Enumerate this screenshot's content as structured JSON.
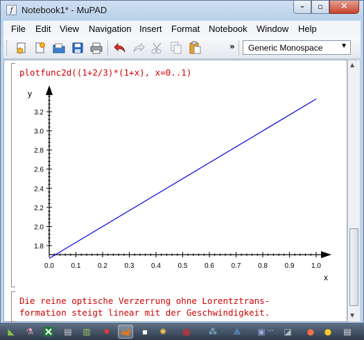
{
  "window": {
    "title": "Notebook1* - MuPAD",
    "app_icon": "mupad-icon",
    "controls": {
      "minimize": "–",
      "maximize": "▫",
      "close": "✕"
    }
  },
  "menubar": {
    "items": [
      "File",
      "Edit",
      "View",
      "Navigation",
      "Insert",
      "Format",
      "Notebook",
      "Window",
      "Help"
    ]
  },
  "toolbar": {
    "buttons": [
      "new-notebook-icon",
      "new-document-icon",
      "open-folder-icon",
      "save-icon",
      "print-icon",
      "undo-icon",
      "redo-icon",
      "cut-icon",
      "copy-icon",
      "paste-icon"
    ],
    "more_label": "»",
    "font_select": {
      "value": "Generic Monospace"
    }
  },
  "notebook": {
    "command": "plotfunc2d((1+2/3)*(1+x), x=0..1)",
    "text_lines": [
      "Die reine optische Verzerrung ohne Lorentztrans-",
      "formation steigt linear mit der Geschwindigkeit."
    ]
  },
  "chart_data": {
    "type": "line",
    "title": "",
    "xlabel": "x",
    "ylabel": "y",
    "xlim": [
      0,
      1
    ],
    "ylim": [
      1.6667,
      3.3333
    ],
    "x_ticks": [
      "0.0",
      "0.1",
      "0.2",
      "0.3",
      "0.4",
      "0.5",
      "0.6",
      "0.7",
      "0.8",
      "0.9",
      "1.0"
    ],
    "y_ticks": [
      "1.8",
      "2.0",
      "2.2",
      "2.4",
      "2.6",
      "2.8",
      "3.0",
      "3.2"
    ],
    "series": [
      {
        "x": [
          0,
          1
        ],
        "y": [
          1.6667,
          3.3333
        ],
        "color": "#0000dd"
      }
    ],
    "grid": false
  },
  "taskbar": {
    "overflow_text": "...",
    "items": [
      "task-a",
      "excel-icon",
      "task-c",
      "task-d",
      "matlab-icon",
      "task-f",
      "task-g",
      "task-h",
      "task-i",
      "task-j",
      "task-k",
      "task-l",
      "task-m",
      "task-n",
      "task-o"
    ]
  }
}
